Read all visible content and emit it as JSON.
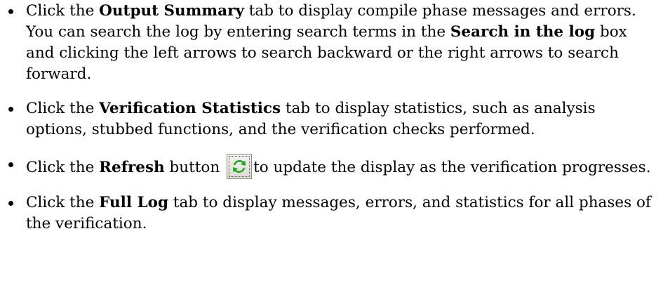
{
  "items": [
    {
      "t1": "Click the ",
      "b1": "Output Summary",
      "t2": " tab to display compile phase messages and errors. You can search the log by entering search terms in the ",
      "b2": "Search in the log",
      "t3": " box and clicking the left arrows to search backward or the right arrows to search forward."
    },
    {
      "t1": "Click the ",
      "b1": "Verification Statistics",
      "t2": " tab to display statistics, such as analysis options, stubbed functions, and the verification checks performed."
    },
    {
      "t1": "Click the ",
      "b1": "Refresh",
      "t2": " button",
      "icon": "refresh-icon",
      "t3": "to update the display as the verification progresses."
    },
    {
      "t1": "Click the ",
      "b1": "Full Log",
      "t2": " tab to display messages, errors, and statistics for all phases of the verification."
    }
  ],
  "colors": {
    "text": "#000000",
    "icon_arrow": "#1fa51f",
    "icon_button_bg": "#e9e8e2"
  }
}
